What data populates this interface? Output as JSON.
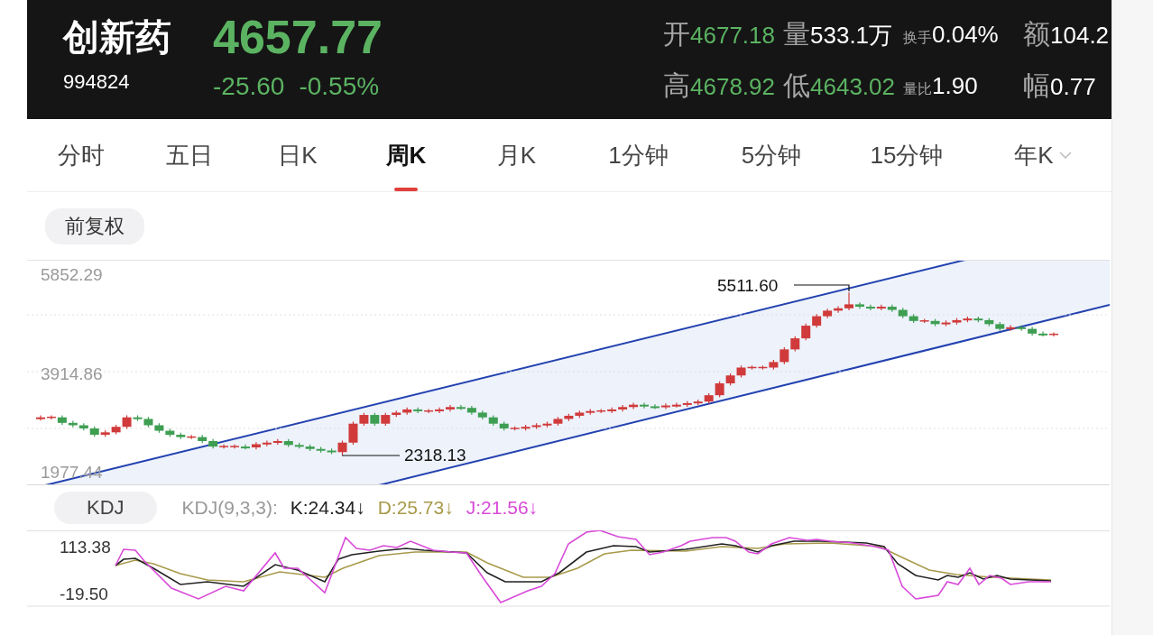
{
  "header": {
    "name": "创新药",
    "code": "994824",
    "price": "4657.77",
    "change": "-25.60",
    "change_pct": "-0.55%",
    "stats": [
      {
        "label": "开",
        "value": "4677.18",
        "kind": "price"
      },
      {
        "label": "量",
        "value": "533.1万",
        "kind": "plain"
      },
      {
        "label": "换手",
        "value": "0.04%",
        "kind": "ratio"
      },
      {
        "label": "额",
        "value": "104.2",
        "kind": "plain"
      },
      {
        "label": "高",
        "value": "4678.92",
        "kind": "price"
      },
      {
        "label": "低",
        "value": "4643.02",
        "kind": "price"
      },
      {
        "label": "量比",
        "value": "1.90",
        "kind": "ratio"
      },
      {
        "label": "幅",
        "value": "0.77",
        "kind": "plain"
      }
    ]
  },
  "tabs": [
    {
      "label": "分时",
      "selected": false,
      "dropdown": false
    },
    {
      "label": "五日",
      "selected": false,
      "dropdown": false
    },
    {
      "label": "日K",
      "selected": false,
      "dropdown": false
    },
    {
      "label": "周K",
      "selected": true,
      "dropdown": false
    },
    {
      "label": "月K",
      "selected": false,
      "dropdown": false
    },
    {
      "label": "1分钟",
      "selected": false,
      "dropdown": false
    },
    {
      "label": "5分钟",
      "selected": false,
      "dropdown": false
    },
    {
      "label": "15分钟",
      "selected": false,
      "dropdown": false
    },
    {
      "label": "年K",
      "selected": false,
      "dropdown": true
    }
  ],
  "adjust_button": "前复权",
  "price_chart": {
    "high_label": "5511.60",
    "low_label": "2318.13",
    "chart_data": {
      "type": "candlestick",
      "ylim": [
        1729.74,
        6153.07
      ],
      "yticks": [
        {
          "value": 5852.29,
          "label": "5852.29"
        },
        {
          "value": 3914.86,
          "label": "3914.86"
        },
        {
          "value": 1977.44,
          "label": "1977.44"
        }
      ],
      "ohlc": [
        [
          3040,
          3102,
          3000,
          3062
        ],
        [
          3062,
          3102,
          3022,
          3062
        ],
        [
          3062,
          3102,
          2914,
          2954
        ],
        [
          2954,
          2994,
          2867,
          2907
        ],
        [
          2907,
          2947,
          2805,
          2845
        ],
        [
          2845,
          2885,
          2681,
          2721
        ],
        [
          2721,
          2808,
          2681,
          2768
        ],
        [
          2768,
          2916,
          2728,
          2876
        ],
        [
          2876,
          3102,
          2836,
          3062
        ],
        [
          3062,
          3102,
          2991,
          3031
        ],
        [
          3031,
          3071,
          2867,
          2907
        ],
        [
          2907,
          2947,
          2759,
          2799
        ],
        [
          2799,
          2839,
          2681,
          2721
        ],
        [
          2721,
          2761,
          2635,
          2675
        ],
        [
          2675,
          2715,
          2635,
          2675
        ],
        [
          2675,
          2715,
          2557,
          2597
        ],
        [
          2597,
          2637,
          2449,
          2489
        ],
        [
          2489,
          2529,
          2449,
          2489
        ],
        [
          2489,
          2529,
          2449,
          2489
        ],
        [
          2489,
          2529,
          2433,
          2473
        ],
        [
          2473,
          2575,
          2433,
          2535
        ],
        [
          2535,
          2606,
          2495,
          2566
        ],
        [
          2566,
          2637,
          2526,
          2597
        ],
        [
          2597,
          2637,
          2480,
          2520
        ],
        [
          2520,
          2560,
          2449,
          2489
        ],
        [
          2489,
          2529,
          2402,
          2442
        ],
        [
          2442,
          2482,
          2371,
          2411
        ],
        [
          2411,
          2451,
          2340,
          2380
        ],
        [
          2380,
          2606,
          2318.13,
          2566
        ],
        [
          2566,
          2978,
          2526,
          2938
        ],
        [
          2938,
          3149,
          2898,
          3109
        ],
        [
          3109,
          3149,
          2898,
          2938
        ],
        [
          2938,
          3149,
          2898,
          3109
        ],
        [
          3109,
          3195,
          3069,
          3155
        ],
        [
          3155,
          3257,
          3115,
          3217
        ],
        [
          3217,
          3257,
          3146,
          3186
        ],
        [
          3186,
          3226,
          3146,
          3186
        ],
        [
          3186,
          3257,
          3146,
          3217
        ],
        [
          3217,
          3304,
          3177,
          3264
        ],
        [
          3264,
          3304,
          3208,
          3248
        ],
        [
          3248,
          3288,
          3115,
          3155
        ],
        [
          3155,
          3195,
          3022,
          3062
        ],
        [
          3062,
          3102,
          2898,
          2938
        ],
        [
          2938,
          2978,
          2805,
          2845
        ],
        [
          2845,
          2885,
          2805,
          2845
        ],
        [
          2845,
          2916,
          2805,
          2876
        ],
        [
          2876,
          2947,
          2836,
          2907
        ],
        [
          2907,
          2978,
          2867,
          2938
        ],
        [
          2938,
          3071,
          2898,
          3031
        ],
        [
          3031,
          3133,
          2991,
          3093
        ],
        [
          3093,
          3195,
          3053,
          3155
        ],
        [
          3155,
          3226,
          3115,
          3186
        ],
        [
          3186,
          3226,
          3146,
          3186
        ],
        [
          3186,
          3257,
          3146,
          3217
        ],
        [
          3217,
          3304,
          3177,
          3264
        ],
        [
          3264,
          3350,
          3224,
          3310
        ],
        [
          3310,
          3350,
          3239,
          3279
        ],
        [
          3279,
          3319,
          3224,
          3264
        ],
        [
          3264,
          3335,
          3224,
          3295
        ],
        [
          3295,
          3350,
          3255,
          3310
        ],
        [
          3310,
          3381,
          3270,
          3341
        ],
        [
          3341,
          3412,
          3301,
          3372
        ],
        [
          3372,
          3536,
          3332,
          3496
        ],
        [
          3496,
          3769,
          3456,
          3729
        ],
        [
          3729,
          3924,
          3689,
          3884
        ],
        [
          3884,
          4079,
          3844,
          4039
        ],
        [
          4039,
          4079,
          3999,
          4039
        ],
        [
          4039,
          4079,
          3999,
          4039
        ],
        [
          4039,
          4187,
          3999,
          4147
        ],
        [
          4147,
          4435,
          4107,
          4395
        ],
        [
          4395,
          4652,
          4355,
          4612
        ],
        [
          4612,
          4900,
          4572,
          4860
        ],
        [
          4860,
          5086,
          4820,
          5046
        ],
        [
          5046,
          5195,
          5006,
          5155
        ],
        [
          5155,
          5241,
          5115,
          5201
        ],
        [
          5201,
          5511.6,
          5161,
          5279
        ],
        [
          5279,
          5319,
          5192,
          5232
        ],
        [
          5232,
          5272,
          5161,
          5201
        ],
        [
          5201,
          5272,
          5161,
          5232
        ],
        [
          5232,
          5272,
          5130,
          5170
        ],
        [
          5170,
          5210,
          5006,
          5046
        ],
        [
          5046,
          5086,
          4913,
          4953
        ],
        [
          4953,
          4993,
          4913,
          4953
        ],
        [
          4953,
          4993,
          4851,
          4891
        ],
        [
          4891,
          4962,
          4851,
          4922
        ],
        [
          4922,
          5009,
          4882,
          4969
        ],
        [
          4969,
          5040,
          4929,
          5000
        ],
        [
          5000,
          5040,
          4929,
          4969
        ],
        [
          4969,
          5009,
          4851,
          4891
        ],
        [
          4891,
          4931,
          4758,
          4798
        ],
        [
          4798,
          4869,
          4758,
          4829
        ],
        [
          4829,
          4869,
          4758,
          4798
        ],
        [
          4798,
          4838,
          4665,
          4705
        ],
        [
          4705,
          4745,
          4650,
          4690
        ],
        [
          4690,
          4730,
          4650,
          4690
        ]
      ]
    }
  },
  "kdj": {
    "button": "KDJ",
    "params": "KDJ(9,3,3):",
    "values": [
      {
        "text": "K:24.34↓",
        "color": "#222222"
      },
      {
        "text": "D:25.73↓",
        "color": "#a89a4a"
      },
      {
        "text": "J:21.56↓",
        "color": "#d84ad8"
      }
    ],
    "y_labels": [
      "113.38",
      "-19.50"
    ]
  }
}
